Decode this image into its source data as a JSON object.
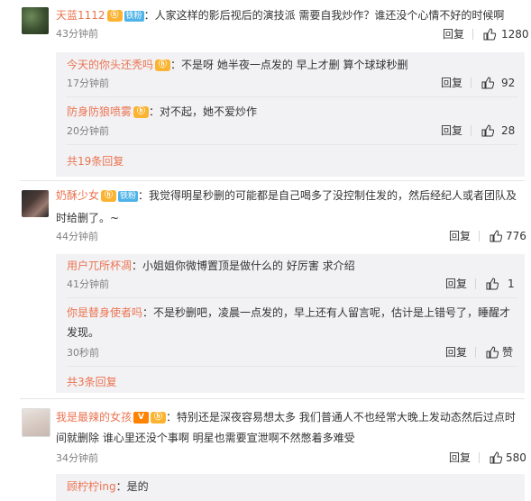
{
  "comments": [
    {
      "user": "天蓝1112",
      "badges": [
        "ⓗ",
        "铁粉"
      ],
      "text": "：人家这样的影后视后的演技派 需要自我炒作？谁还没个心情不好的时候啊",
      "time": "43分钟前",
      "reply_label": "回复",
      "likes": "1280",
      "replies": [
        {
          "user": "今天的你头还秃吗",
          "text": "：不是呀 她半夜一点发的 早上才删 算个球球秒删",
          "time": "17分钟前",
          "reply_label": "回复",
          "likes": "92"
        },
        {
          "user": "防身防狼喷雾",
          "text": "：对不起，她不爱炒作",
          "time": "20分钟前",
          "reply_label": "回复",
          "likes": "28"
        }
      ],
      "more": "共19条回复"
    },
    {
      "user": "奶酥少女",
      "badges": [
        "ⓗ",
        "铁粉"
      ],
      "text_line1": "：我觉得明星秒删的可能都是自己喝多了没控制住发的，然后经纪人或者团队及",
      "text_line2": "时给删了。~",
      "time": "44分钟前",
      "reply_label": "回复",
      "likes": "776",
      "replies": [
        {
          "user": "用户兀所杯凋",
          "text": "：小姐姐你微博置顶是做什么的 好厉害 求介绍",
          "time": "41分钟前",
          "reply_label": "回复",
          "likes": "1"
        },
        {
          "user": "你是替身使者吗",
          "text_line1": "：不是秒删吧，凌晨一点发的，早上还有人留言呢，估计是上错号了，睡醒才",
          "text_line2": "发现。",
          "time": "30秒前",
          "reply_label": "回复",
          "likes": "赞"
        }
      ],
      "more": "共3条回复"
    },
    {
      "user": "我是最辣的女孩",
      "badges": [
        "V",
        "ⓗ"
      ],
      "text_line1": "：特别还是深夜容易想太多 我们普通人不也经常大晚上发动态然后过点时",
      "text_line2": "间就删除 谁心里还没个事啊 明星也需要宣泄啊不然憋着多难受",
      "time": "34分钟前",
      "reply_label": "回复",
      "likes": "580",
      "replies": [
        {
          "user": "顾柠柠ing",
          "text": "：是的"
        }
      ]
    }
  ],
  "colors": {
    "username": "#eb7350",
    "reply_bg": "#f2f2f5",
    "fan_badge": "#4eb3e8",
    "level_badge": "#fbb332",
    "vip_badge": "#ff8200"
  }
}
